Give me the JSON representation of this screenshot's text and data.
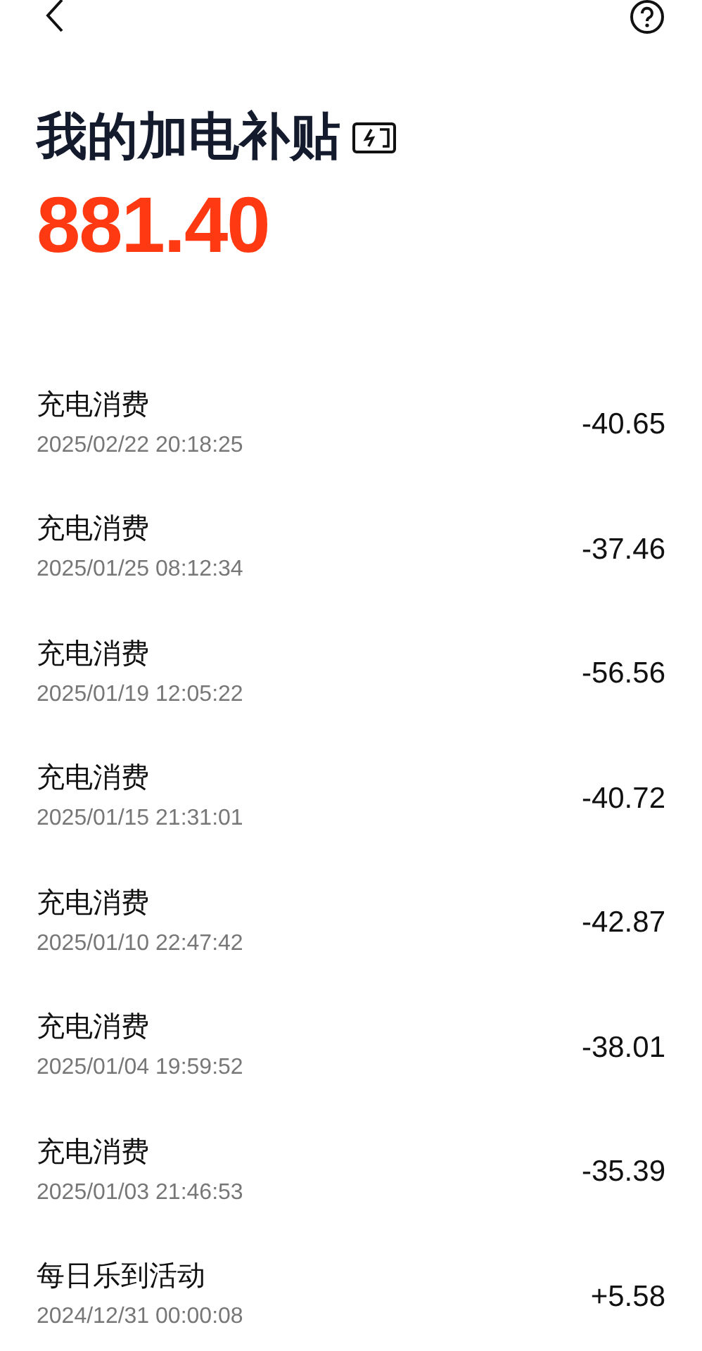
{
  "title": "我的加电补贴",
  "balance": "881.40",
  "records": [
    {
      "name": "充电消费",
      "time": "2025/02/22 20:18:25",
      "amount": "-40.65"
    },
    {
      "name": "充电消费",
      "time": "2025/01/25 08:12:34",
      "amount": "-37.46"
    },
    {
      "name": "充电消费",
      "time": "2025/01/19 12:05:22",
      "amount": "-56.56"
    },
    {
      "name": "充电消费",
      "time": "2025/01/15 21:31:01",
      "amount": "-40.72"
    },
    {
      "name": "充电消费",
      "time": "2025/01/10 22:47:42",
      "amount": "-42.87"
    },
    {
      "name": "充电消费",
      "time": "2025/01/04 19:59:52",
      "amount": "-38.01"
    },
    {
      "name": "充电消费",
      "time": "2025/01/03 21:46:53",
      "amount": "-35.39"
    },
    {
      "name": "每日乐到活动",
      "time": "2024/12/31 00:00:08",
      "amount": "+5.58"
    }
  ]
}
